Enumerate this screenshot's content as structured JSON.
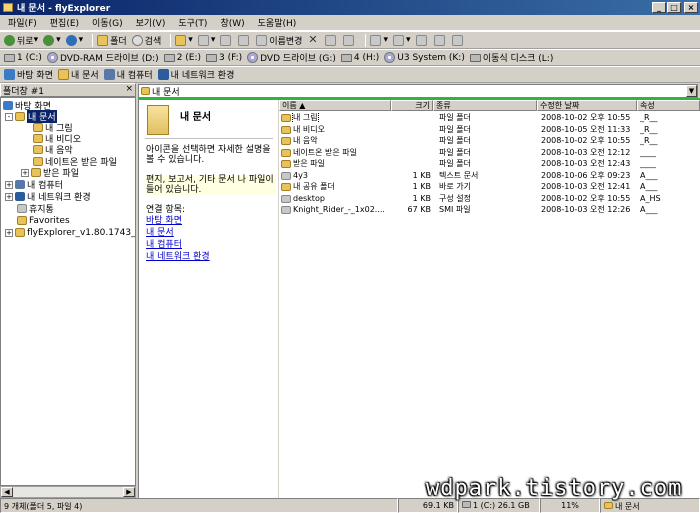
{
  "window": {
    "title": "내 문서 - flyExplorer"
  },
  "menu": [
    "파일(F)",
    "편집(E)",
    "이동(G)",
    "보기(V)",
    "도구(T)",
    "창(W)",
    "도움말(H)"
  ],
  "toolbar": {
    "back_label": "뒤로",
    "folder_label": "폴더",
    "search_label": "검색",
    "rename_label": "이름변경"
  },
  "drives": [
    {
      "label": "1 (C:)"
    },
    {
      "label": "DVD-RAM 드라이브 (D:)"
    },
    {
      "label": "2 (E:)"
    },
    {
      "label": "3 (F:)"
    },
    {
      "label": "DVD 드라이브 (G:)"
    },
    {
      "label": "4 (H:)"
    },
    {
      "label": "U3 System (K:)"
    },
    {
      "label": "이동식 디스크 (L:)"
    }
  ],
  "places": [
    "바탕 화면",
    "내 문서",
    "내 컴퓨터",
    "내 네트워크 환경"
  ],
  "folder_panel": {
    "title": "폴더창 #1",
    "close": "×"
  },
  "tree": [
    {
      "label": "바탕 화면"
    },
    {
      "label": "내 문서"
    },
    {
      "label": "내 그림"
    },
    {
      "label": "내 비디오"
    },
    {
      "label": "내 음악"
    },
    {
      "label": "네이트온 받은 파일"
    },
    {
      "label": "받은 파일"
    },
    {
      "label": "내 컴퓨터"
    },
    {
      "label": "내 네트워크 환경"
    },
    {
      "label": "휴지통"
    },
    {
      "label": "Favorites"
    },
    {
      "label": "flyExplorer_v1.80.1743_port"
    }
  ],
  "address": {
    "value": "내 문서"
  },
  "info_pane": {
    "title": "내 문서",
    "desc": "아이콘을 선택하면 자세한 설명을 볼 수 있습니다.",
    "tip": "편지, 보고서, 기타 문서 나 파일이 들어 있습니다.",
    "links_heading": "연결 항목:",
    "links": [
      "바탕 화면",
      "내 문서",
      "내 컴퓨터",
      "내 네트워크 환경"
    ]
  },
  "columns": {
    "name": "이름",
    "size": "크기",
    "type": "종류",
    "modified": "수정한 날짜",
    "attr": "속성"
  },
  "files": [
    {
      "name": "내 그림",
      "size": "",
      "type": "파일 폴더",
      "modified": "2008-10-02 오후 10:55",
      "attr": "_R__"
    },
    {
      "name": "내 비디오",
      "size": "",
      "type": "파일 폴더",
      "modified": "2008-10-05 오전 11:33",
      "attr": "_R__"
    },
    {
      "name": "내 음악",
      "size": "",
      "type": "파일 폴더",
      "modified": "2008-10-02 오후 10:55",
      "attr": "_R__"
    },
    {
      "name": "네이트온 받은 파일",
      "size": "",
      "type": "파일 폴더",
      "modified": "2008-10-03 오전 12:12",
      "attr": "____"
    },
    {
      "name": "받은 파일",
      "size": "",
      "type": "파일 폴더",
      "modified": "2008-10-03 오전 12:43",
      "attr": "____"
    },
    {
      "name": "4y3",
      "size": "1 KB",
      "type": "텍스트 문서",
      "modified": "2008-10-06 오후 09:23",
      "attr": "A___"
    },
    {
      "name": "내 공유 폴더",
      "size": "1 KB",
      "type": "바로 가기",
      "modified": "2008-10-03 오전 12:41",
      "attr": "A___"
    },
    {
      "name": "desktop",
      "size": "1 KB",
      "type": "구성 설정",
      "modified": "2008-10-02 오후 10:55",
      "attr": "A_HS"
    },
    {
      "name": "Knight_Rider_-_1x02....",
      "size": "67 KB",
      "type": "SMI 파일",
      "modified": "2008-10-03 오전 12:26",
      "attr": "A___"
    }
  ],
  "status": {
    "count": "9 개체(폴더 5, 파일 4)",
    "size": "69.1 KB",
    "drive": "1 (C:) 26.1 GB",
    "percent": "11%",
    "location": "내 문서"
  },
  "watermark": "wdpark.tistory.com"
}
